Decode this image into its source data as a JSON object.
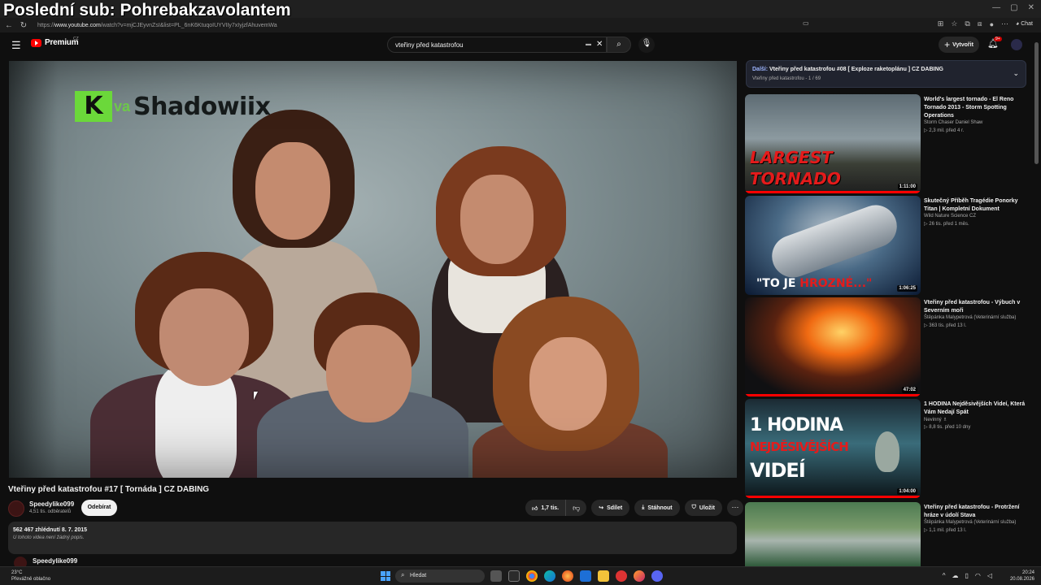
{
  "overlay_title": "Poslední sub: Pohrebakzavolantem",
  "browser": {
    "url_prefix": "https://",
    "url_host": "www.youtube.com",
    "url_path": "/watch?v=mjCJEyvnZsI&list=PL_6nK6KtuqoIUYVIIy7xIyjzfAhuvemWa",
    "chat_label": "Chat"
  },
  "header": {
    "logo_text": "Premium",
    "logo_country": "CZ",
    "search_value": "vteřiny před katastrofou",
    "create_label": "Vytvořit",
    "notif_count": "9+"
  },
  "player": {
    "watermark_letter": "K",
    "watermark_va": "va",
    "watermark_text": "Shadowiix"
  },
  "video": {
    "title": "Vteřiny před katastrofou #17 [ Tornáda ] CZ DABING",
    "channel": "Speedylike099",
    "subscribers": "4,51 tis. odběratelů",
    "subscribe_label": "Odebírat",
    "likes": "1,7 tis.",
    "share_label": "Sdílet",
    "download_label": "Stáhnout",
    "save_label": "Uložit",
    "stats": "562 467 zhlédnutí  8. 7. 2015",
    "description": "U tohoto videa není žádný popis.",
    "comment_author": "Speedylike099"
  },
  "playlist": {
    "next_prefix": "Další:",
    "next_title": "Vteřiny před katastrofou #08 [ Exploze raketoplánu ] CZ DABING",
    "sub": "Vteřiny před katastrofou - 1 / 69"
  },
  "recommendations": [
    {
      "title": "World's largest tornado - El Reno Tornado 2013 - Storm Spotting Operations",
      "channel": "Storm Chaser Daniel Shaw",
      "meta": "▷ 2,3 mil.  před 4 r.",
      "duration": "1:11:00",
      "thumb_line1": "LARGEST",
      "thumb_line2": "TORNADO"
    },
    {
      "title": "Skutečný Příběh Tragédie Ponorky Titan | Kompletní Dokument",
      "channel": "Wild Nature Science CZ",
      "meta": "▷ 26 tis.  před 1 měs.",
      "duration": "1:06:25",
      "thumb_line1": "\"TO JE ",
      "thumb_line2": "HROZNÉ...\""
    },
    {
      "title": "Vteřiny před katastrofou - Výbuch v Severním moři",
      "channel": "Štěpánka Malypetrová (Veterinární služba)",
      "meta": "▷ 363 tis.  před 13 l.",
      "duration": "47:02"
    },
    {
      "title": "1 HODINA Nejděsivějších Videí, Která Vám Nedají Spát",
      "channel": "Nevinný ♗",
      "meta": "▷ 8,8 tis.  před 10 dny",
      "duration": "1:04:00",
      "thumb_line1": "1 HODINA",
      "thumb_line2": "NEJDĚSIVĚJŠÍCH",
      "thumb_line3": "VIDEÍ"
    },
    {
      "title": "Vteřiny před katastrofou - Protržení hráze v údolí Stava",
      "channel": "Štěpánka Malypetrová (Veterinární služba)",
      "meta": "▷ 1,1 mil.  před 13 l."
    }
  ],
  "taskbar": {
    "temp": "23°C",
    "weather": "Převážně oblačno",
    "search_label": "Hledat",
    "time": "20:24",
    "date": "20.08.2026"
  }
}
